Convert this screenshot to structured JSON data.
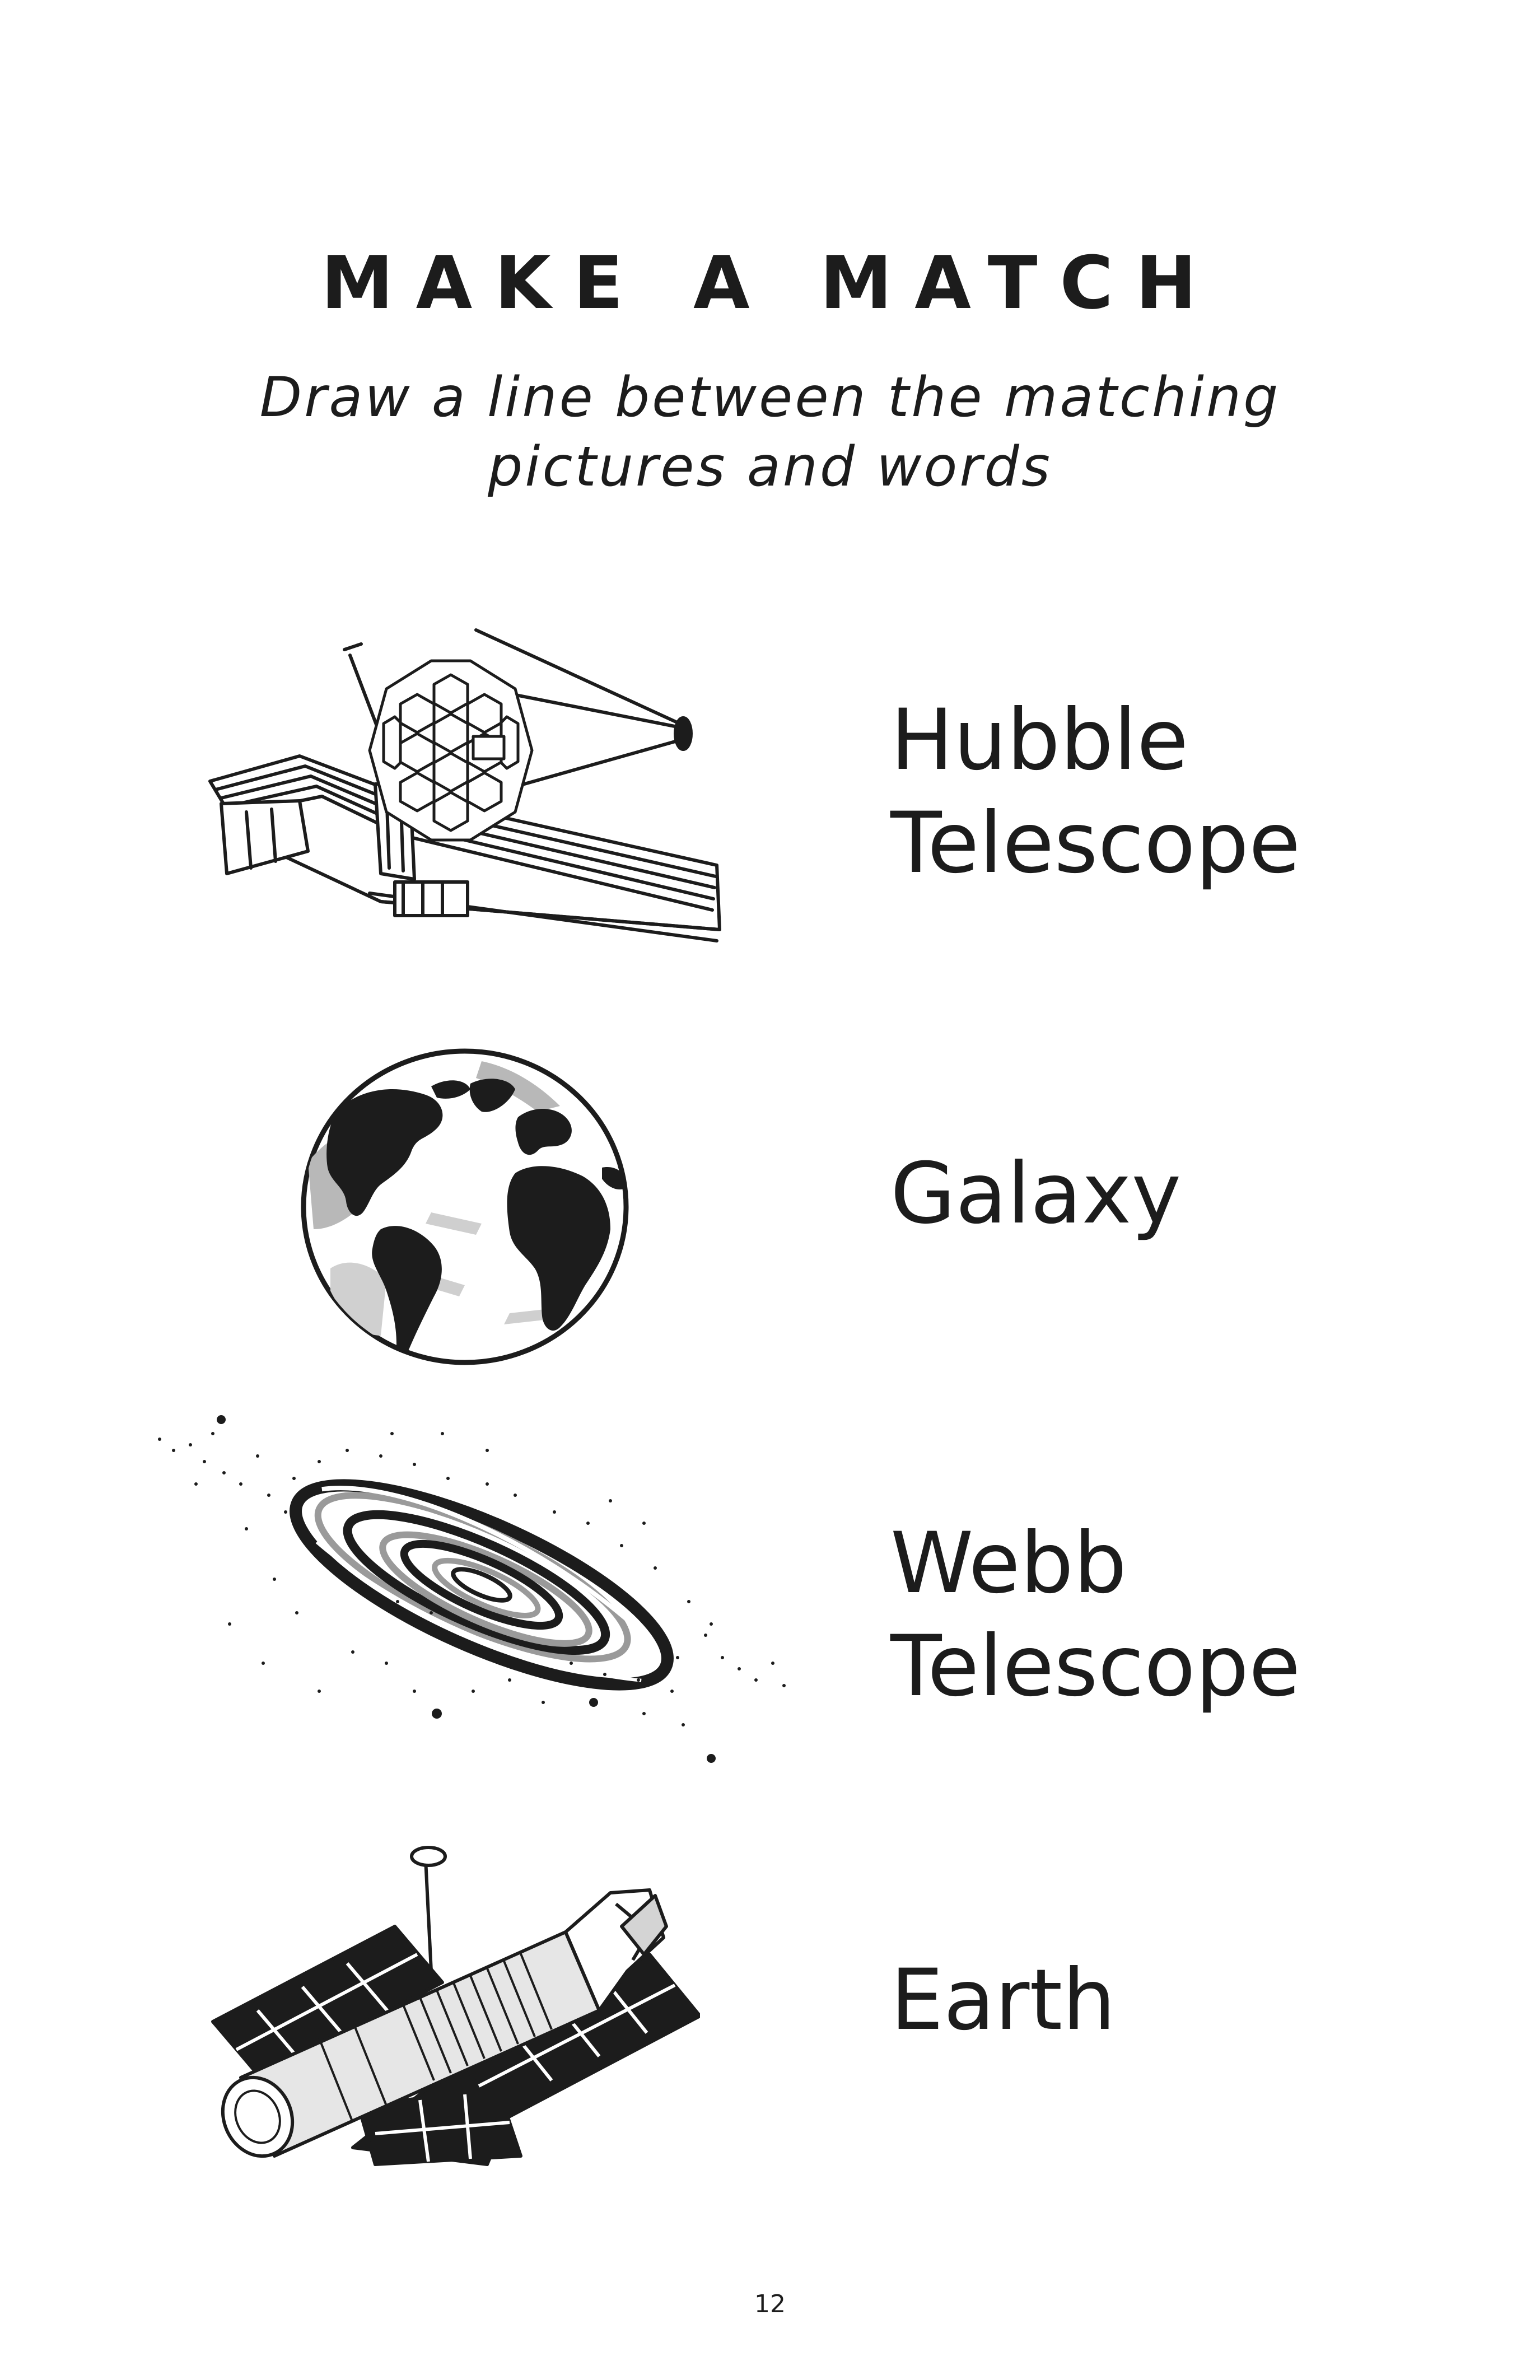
{
  "page": {
    "title": "MAKE A MATCH",
    "instructions": "Draw a line between the matching\npictures and words",
    "page_number": "12"
  },
  "pictures": [
    {
      "icon": "webb-telescope-icon"
    },
    {
      "icon": "earth-globe-icon"
    },
    {
      "icon": "spiral-galaxy-icon"
    },
    {
      "icon": "hubble-telescope-icon"
    }
  ],
  "words": [
    "Hubble\nTelescope",
    "Galaxy",
    "Webb\nTelescope",
    "Earth"
  ],
  "colors": {
    "ink": "#1c1c1c",
    "grey": "#9a9a9a",
    "light_grey": "#d4d4d4",
    "paper": "#ffffff"
  }
}
